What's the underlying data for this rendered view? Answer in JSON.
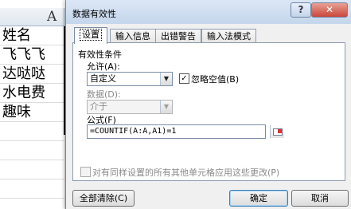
{
  "sheet": {
    "column_header": "A",
    "cells": [
      "姓名",
      "飞飞飞",
      "达哒哒",
      "水电费",
      "趣味"
    ]
  },
  "dialog": {
    "title": "数据有效性",
    "help_label": "?",
    "close_label": "✕",
    "tabs": [
      {
        "label": "设置",
        "active": true
      },
      {
        "label": "输入信息",
        "active": false
      },
      {
        "label": "出错警告",
        "active": false
      },
      {
        "label": "输入法模式",
        "active": false
      }
    ],
    "section_title": "有效性条件",
    "allow": {
      "label": "允许(A):",
      "value": "自定义"
    },
    "ignore_blank": {
      "label": "忽略空值(B)",
      "checked": true
    },
    "data": {
      "label": "数据(D):",
      "value": "介于"
    },
    "formula": {
      "label": "公式(F)",
      "value": "=COUNTIF(A:A,A1)=1"
    },
    "apply_all": {
      "label": "对有同样设置的所有其他单元格应用这些更改(P)",
      "checked": false
    },
    "buttons": {
      "clear_all": "全部清除(C)",
      "ok": "确定",
      "cancel": "取消"
    }
  }
}
